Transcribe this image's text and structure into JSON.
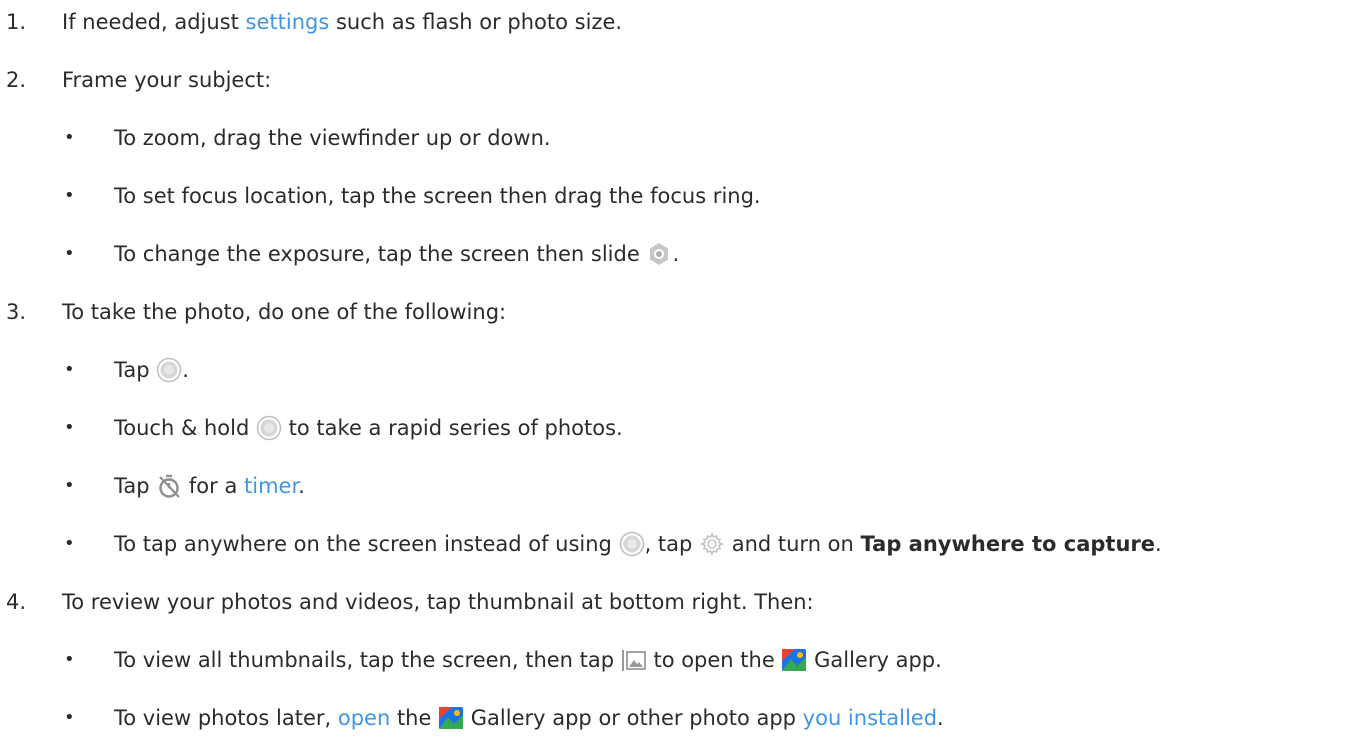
{
  "steps": [
    {
      "number": "1.",
      "pre": "If needed, adjust ",
      "link": "settings",
      "post": " such as flash or photo size."
    },
    {
      "number": "2.",
      "text": "Frame your subject:",
      "bullets": [
        "To zoom, drag the viewfinder up or down.",
        "To set focus location, tap the screen then drag the focus ring.",
        {
          "pre": "To change the exposure, tap the screen then slide ",
          "icon": "exposure-icon",
          "post": "."
        }
      ]
    },
    {
      "number": "3.",
      "text": "To take the photo, do one of the following:",
      "bullets": [
        {
          "pre": "Tap ",
          "icon": "shutter-icon",
          "post": "."
        },
        {
          "pre": "Touch & hold ",
          "icon": "shutter-icon",
          "post": " to take a rapid series of photos."
        },
        {
          "pre": "Tap ",
          "icon": "timer-icon",
          "mid": " for a ",
          "link": "timer",
          "post": "."
        },
        {
          "pre": "To tap anywhere on the screen instead of using ",
          "icon": "shutter-icon",
          "mid": ", tap ",
          "icon2": "settings-gear-icon",
          "mid2": " and turn on ",
          "bold": "Tap anywhere to capture",
          "post": "."
        }
      ]
    },
    {
      "number": "4.",
      "text": "To review your photos and videos, tap thumbnail at bottom right. Then:",
      "bullets": [
        {
          "pre": "To view all thumbnails, tap the screen, then tap ",
          "icon": "gallery-thumb-icon",
          "mid": " to open the ",
          "icon2": "gallery-app-icon",
          "post": " Gallery app."
        },
        {
          "link1": "open",
          "pre": "To view photos later, ",
          "mid": " the ",
          "icon": "gallery-app-icon",
          "mid2": " Gallery app or other photo app ",
          "link2": "you installed",
          "post": "."
        }
      ]
    }
  ],
  "bullet_char": "•"
}
